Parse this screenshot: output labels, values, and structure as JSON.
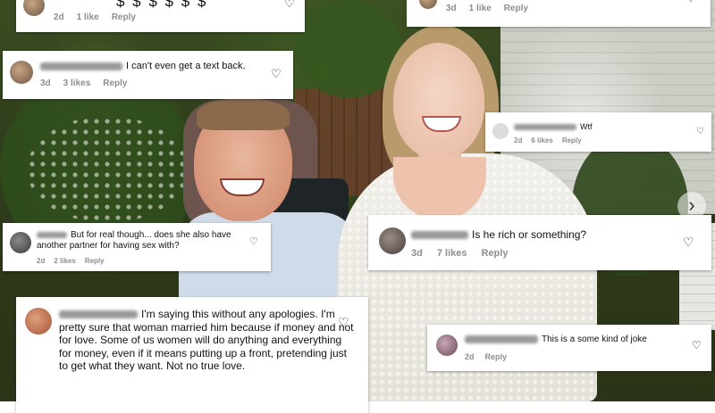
{
  "comments": [
    {
      "id": "c1",
      "text": "$ $ $ $ $ $",
      "time": "2d",
      "likes": "1 like",
      "reply": "Reply"
    },
    {
      "id": "c2",
      "text": "",
      "time": "3d",
      "likes": "1 like",
      "reply": "Reply"
    },
    {
      "id": "c3",
      "text": "I can't even get a text back.",
      "time": "3d",
      "likes": "3 likes",
      "reply": "Reply"
    },
    {
      "id": "c4",
      "text": "Wtf",
      "time": "2d",
      "likes": "6 likes",
      "reply": "Reply"
    },
    {
      "id": "c5",
      "text": "But for real though... does she also have another partner for having sex with?",
      "time": "2d",
      "likes": "2 likes",
      "reply": "Reply"
    },
    {
      "id": "c6",
      "text": "Is he rich or something?",
      "time": "3d",
      "likes": "7 likes",
      "reply": "Reply"
    },
    {
      "id": "c7",
      "text": "I'm saying this without any apologies. I'm pretty sure that woman married him because if money and not for love. Some of us women will do anything and everything for money, even if it means putting up a front, pretending just to get what they want. Not no true love.",
      "time": "",
      "likes": "",
      "reply": ""
    },
    {
      "id": "c8",
      "text": "This is a some kind of joke",
      "time": "2d",
      "likes": "",
      "reply": "Reply"
    }
  ],
  "icons": {
    "heart": "♡",
    "chevron": "›"
  },
  "colors": {
    "meta": "#8e8e8e",
    "card": "#ffffff",
    "text": "#111111"
  }
}
